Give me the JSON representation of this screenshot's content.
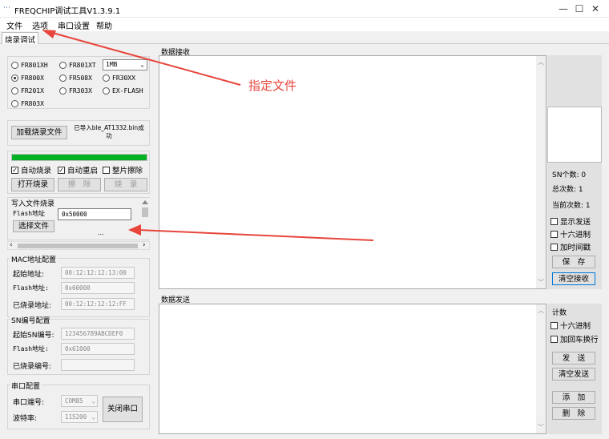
{
  "window": {
    "title": "FREQCHIP调试工具V1.3.9.1",
    "minimize": "—",
    "maximize": "☐",
    "close": "✕"
  },
  "menu": [
    "文件",
    "选项",
    "串口设置",
    "帮助"
  ],
  "tab": "烧录调试",
  "chips": [
    {
      "label": "FR801XH",
      "selected": false
    },
    {
      "label": "FR801XT",
      "selected": false
    },
    {
      "label": "FR800X",
      "selected": true
    },
    {
      "label": "FR508X",
      "selected": false
    },
    {
      "label": "FR30XX",
      "selected": false
    },
    {
      "label": "FR201X",
      "selected": false
    },
    {
      "label": "FR303X",
      "selected": false
    },
    {
      "label": "EX-FLASH",
      "selected": false
    },
    {
      "label": "FR803X",
      "selected": false
    }
  ],
  "flash_size": "1MB",
  "load_button": "加载烧录文件",
  "load_status": "已导入ble_AT1332.bin成功",
  "progress": 1.0,
  "checks": {
    "auto_burn": "自动烧录",
    "auto_restart": "自动重启",
    "full_erase": "整片擦除"
  },
  "buttons": {
    "open_burn": "打开烧录",
    "erase": "擦　除",
    "burn": "烧　录"
  },
  "write_file": {
    "title": "写入文件烧录",
    "flash_label": "Flash地址",
    "flash_value": "0x50000",
    "select_button": "选择文件",
    "ellipsis": "..."
  },
  "mac": {
    "title": "MAC地址配置",
    "start_label": "起始地址:",
    "start_value": "00:12:12:12:13:00",
    "flash_label": "Flash地址:",
    "flash_value": "0x60000",
    "burned_label": "已烧录地址:",
    "burned_value": "00:12:12:12:12:FF"
  },
  "sn": {
    "title": "SN编号配置",
    "start_label": "起始SN编号:",
    "start_value": "123456789ABCDEF0",
    "flash_label": "Flash地址:",
    "flash_value": "0x61000",
    "burned_label": "已烧录编号:",
    "burned_value": ""
  },
  "serial": {
    "title": "串口配置",
    "port_label": "串口端号:",
    "port_value": "COM85",
    "baud_label": "波特率:",
    "baud_value": "115200",
    "close_button": "关闭串口"
  },
  "receive": {
    "title": "数据接收",
    "sn_count": "SN个数: 0",
    "total": "总次数: 1",
    "current": "当前次数: 1",
    "show_send": "显示发送",
    "hex": "十六进制",
    "timestamp": "加时间戳",
    "save": "保　存",
    "clear": "清空接收"
  },
  "send": {
    "title": "数据发送",
    "count": "计数",
    "hex": "十六进制",
    "crlf": "加回车换行",
    "send_button": "发　送",
    "clear": "清空发送",
    "add": "添　加",
    "delete": "删　除"
  },
  "annotation": {
    "text": "指定文件",
    "color": "#e8453c"
  },
  "colors": {
    "progress": "#06b025",
    "accent": "#0078d7",
    "annotation": "#e8453c"
  }
}
